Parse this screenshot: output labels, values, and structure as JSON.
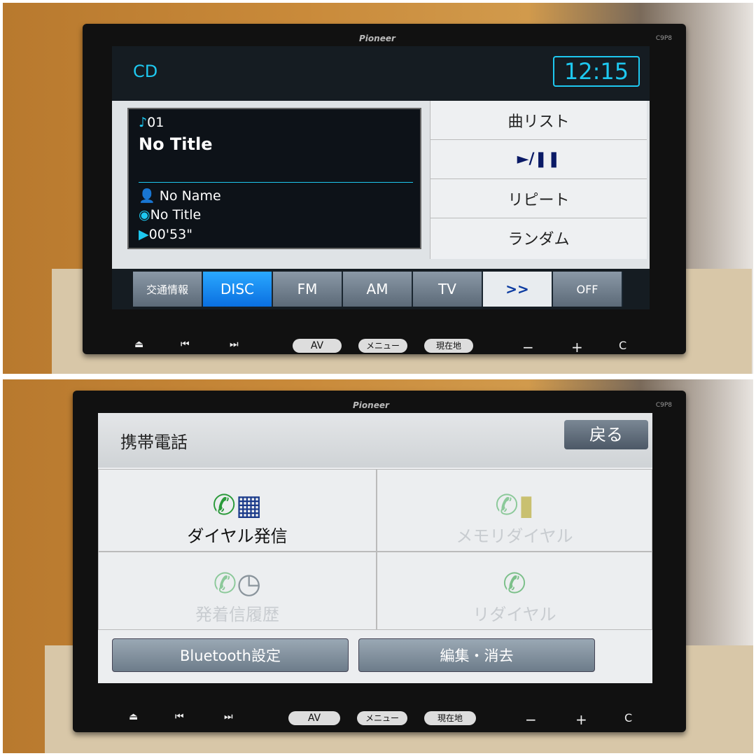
{
  "top_unit": {
    "brand": "Pioneer",
    "model": "C9P8",
    "source": "CD",
    "clock": "12:15",
    "track_number": "01",
    "track_title": "No Title",
    "artist": "No Name",
    "album": "No Title",
    "elapsed": "00'53\"",
    "side_menu": [
      "曲リスト",
      "►/❚❚",
      "リピート",
      "ランダム"
    ],
    "source_tabs": [
      "交通情報",
      "DISC",
      "FM",
      "AM",
      "TV",
      ">>",
      "OFF"
    ],
    "active_tab": "DISC",
    "accent": "#00c8f0"
  },
  "bottom_unit": {
    "brand": "Pioneer",
    "model": "C9P8",
    "title": "携帯電話",
    "back_label": "戻る",
    "grid": [
      {
        "label": "ダイヤル発信",
        "icon": "dial-keypad-phone",
        "enabled": true
      },
      {
        "label": "メモリダイヤル",
        "icon": "phonebook",
        "enabled": false
      },
      {
        "label": "発着信履歴",
        "icon": "clock-phone",
        "enabled": false
      },
      {
        "label": "リダイヤル",
        "icon": "phone-handset",
        "enabled": false
      }
    ],
    "buttons": [
      "Bluetooth設定",
      "編集・消去"
    ]
  },
  "hardware_buttons": {
    "eject": "⏏",
    "prev": "⏮",
    "next": "⏭",
    "av": "AV",
    "menu": "メニュー",
    "location": "現在地",
    "minus": "−",
    "plus": "+",
    "c": "C"
  }
}
